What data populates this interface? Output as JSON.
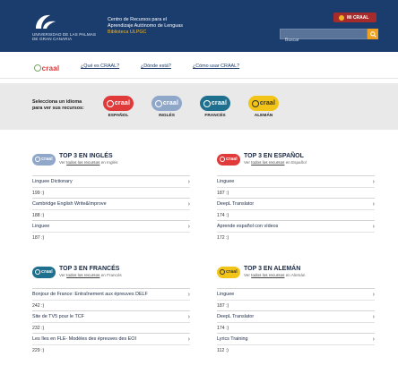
{
  "header": {
    "org_line1": "UNIVERSIDAD DE LAS PALMAS",
    "org_line2": "DE GRAN CANARIA",
    "title_line1": "Centro de Recursos para el",
    "title_line2": "Aprendizaje Autónomo de Lenguas",
    "title_line3": "Biblioteca ULPGC",
    "badge": "Mi CRAAL",
    "search_placeholder": "Buscar"
  },
  "nav": {
    "logo": "craal",
    "links": [
      "¿Qué es CRAAL?",
      "¿Dónde está?",
      "¿Cómo usar CRAAL?"
    ]
  },
  "language_selector": {
    "intro_line1": "Selecciona un idioma",
    "intro_line2": "para ver sus recursos:",
    "items": [
      {
        "label": "ESPAÑOL",
        "logo": "craal",
        "color": "#e03a3a"
      },
      {
        "label": "INGLÉS",
        "logo": "craal",
        "color": "#8fa7c9"
      },
      {
        "label": "FRANCÉS",
        "logo": "craal",
        "color": "#1f6f8f"
      },
      {
        "label": "ALEMÁN",
        "logo": "craal",
        "color": "#f2c418"
      }
    ]
  },
  "sections": [
    {
      "title": "TOP 3 EN INGLÉS",
      "sub_prefix": "Ver ",
      "sub_link": "todos los recursos",
      "sub_suffix": " en Inglés",
      "logo": "craal",
      "color": "#8fa7c9",
      "items": [
        {
          "name": "Linguee Dictionary",
          "count": "199 :)"
        },
        {
          "name": "Cambridge English Write&Improve",
          "count": "188 :)"
        },
        {
          "name": "Linguee",
          "count": "187 :)"
        }
      ]
    },
    {
      "title": "TOP 3 EN ESPAÑOL",
      "sub_prefix": "Ver ",
      "sub_link": "todos los recursos",
      "sub_suffix": " en Español",
      "logo": "craal",
      "color": "#e03a3a",
      "items": [
        {
          "name": "Linguee",
          "count": "187 :)"
        },
        {
          "name": "DeepL Translator",
          "count": "174 :)"
        },
        {
          "name": "Aprende español con vídeos",
          "count": "172 :)"
        }
      ]
    },
    {
      "title": "TOP 3 EN FRANCÉS",
      "sub_prefix": "Ver ",
      "sub_link": "todos los recursos",
      "sub_suffix": " en Francés",
      "logo": "craal",
      "color": "#1f6f8f",
      "items": [
        {
          "name": "Bonjour de France: Entraînement aux épreuves DELF",
          "count": "242 :)"
        },
        {
          "name": "Site de TV5 pour le TCF",
          "count": "232 :)"
        },
        {
          "name": "Les îles en FLE- Modèles des épreuves des EOI",
          "count": "229 :)"
        }
      ]
    },
    {
      "title": "TOP 3 EN ALEMÁN",
      "sub_prefix": "Ver ",
      "sub_link": "todos los recursos",
      "sub_suffix": " en Alemán",
      "logo": "craal",
      "color": "#f2c418",
      "items": [
        {
          "name": "Linguee",
          "count": "187 :)"
        },
        {
          "name": "DeepL Translator",
          "count": "174 :)"
        },
        {
          "name": "Lyrics Training",
          "count": "112 :)"
        }
      ]
    }
  ],
  "icons": {
    "row_chevron": "›",
    "search": "search-icon"
  },
  "colors": {
    "header_bg": "#1a3d6e",
    "accent_orange": "#f0a020",
    "badge_red": "#a62b2b"
  }
}
